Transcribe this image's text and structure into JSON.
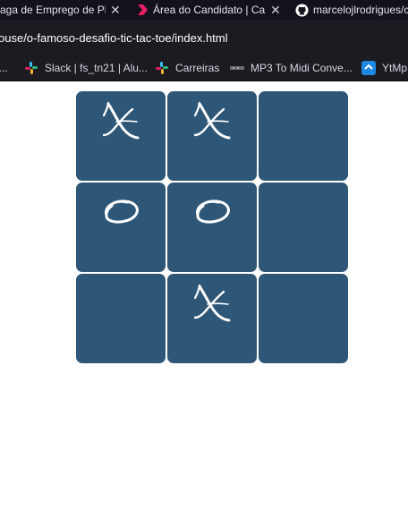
{
  "browser": {
    "tabs": [
      {
        "title": "aga de Emprego de Pl",
        "close": "✕"
      },
      {
        "title": "Área do Candidato | Ca",
        "close": "✕"
      },
      {
        "title": "marcelojlrodrigues/c",
        "close": ""
      }
    ],
    "url": "ouse/o-famoso-desafio-tic-tac-toe/index.html",
    "bookmarks": [
      {
        "label": "i...",
        "icon": "slack-icon"
      },
      {
        "label": "Slack | fs_tn21 | Alu...",
        "icon": "slack-icon"
      },
      {
        "label": "Carreiras",
        "icon": "slack-icon"
      },
      {
        "label": "MP3 To Midi Conve...",
        "icon": "music-icon"
      },
      {
        "label": "YtMp",
        "icon": "download-icon"
      }
    ]
  },
  "game": {
    "board": [
      "X",
      "X",
      "",
      "O",
      "O",
      "",
      "",
      "X",
      ""
    ],
    "colors": {
      "cell": "#2e5777",
      "mark": "#ffffff",
      "background": "#ffffff"
    }
  }
}
